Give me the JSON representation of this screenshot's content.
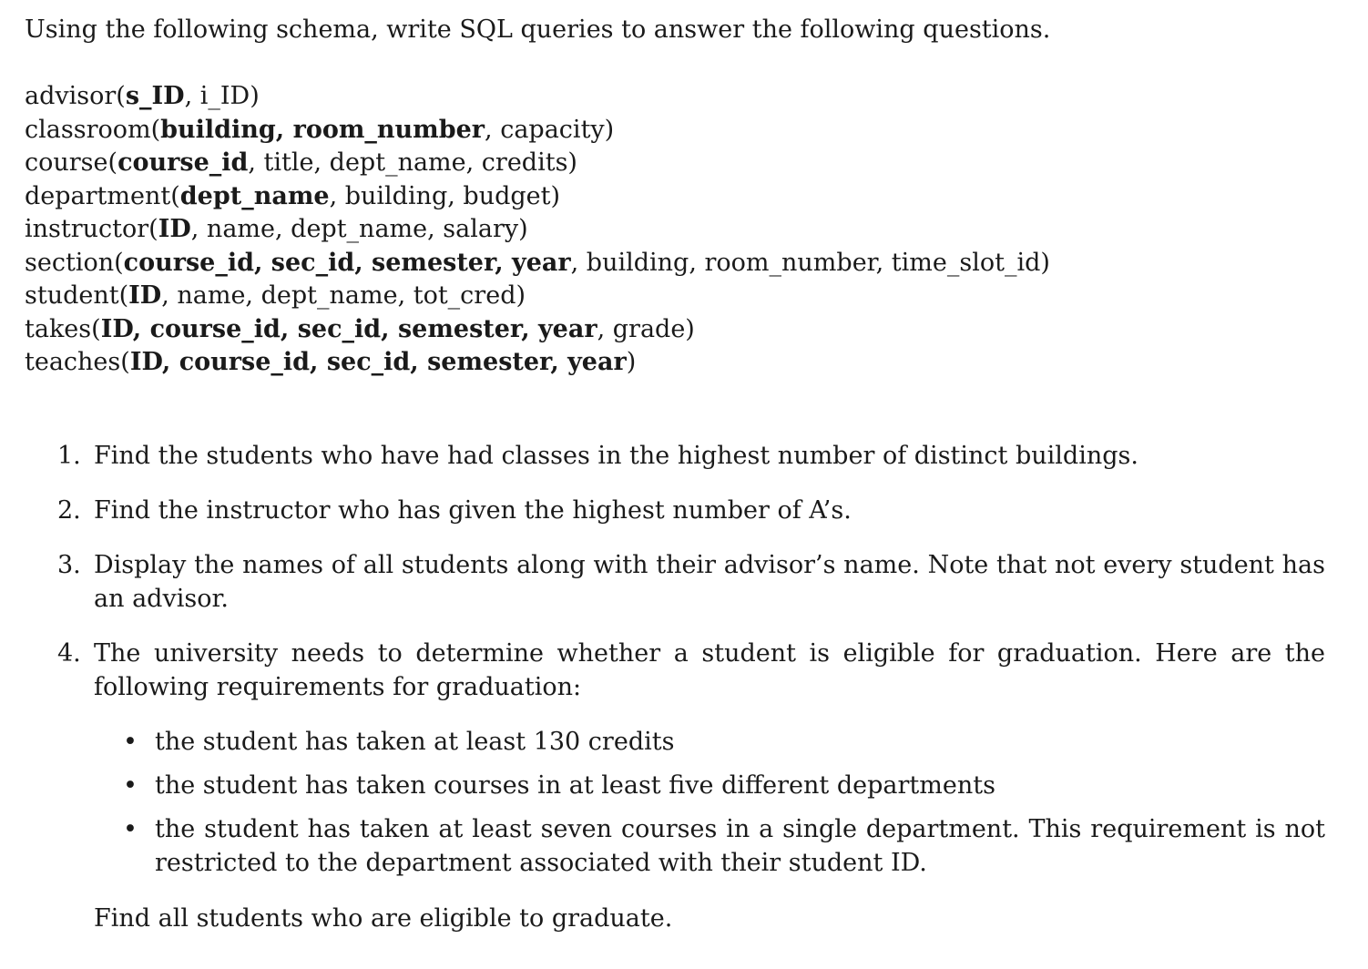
{
  "intro": "Using the following schema, write SQL queries to answer the following questions.",
  "schema": [
    {
      "name": "advisor",
      "open": "(",
      "key": "s_ID",
      "rest": ", i_ID)"
    },
    {
      "name": "classroom",
      "open": "(",
      "key": "building, room_number",
      "rest": ", capacity)"
    },
    {
      "name": "course",
      "open": "(",
      "key": "course_id",
      "rest": ", title, dept_name, credits)"
    },
    {
      "name": "department",
      "open": "(",
      "key": "dept_name",
      "rest": ", building, budget)"
    },
    {
      "name": "instructor",
      "open": "(",
      "key": "ID",
      "rest": ", name, dept_name, salary)"
    },
    {
      "name": "section",
      "open": "(",
      "key": "course_id, sec_id, semester, year",
      "rest": ", building, room_number, time_slot_id)"
    },
    {
      "name": "student",
      "open": "(",
      "key": "ID",
      "rest": ", name, dept_name, tot_cred)"
    },
    {
      "name": "takes",
      "open": "(",
      "key": "ID, course_id, sec_id, semester, year",
      "rest": ", grade)"
    },
    {
      "name": "teaches",
      "open": "(",
      "key": "ID, course_id, sec_id, semester, year",
      "rest": ")"
    }
  ],
  "questions": [
    {
      "num": "1.",
      "text": "Find the students who have had classes in the highest number of distinct buildings."
    },
    {
      "num": "2.",
      "text": "Find the instructor who has given the highest number of A’s."
    },
    {
      "num": "3.",
      "text": "Display the names of all students along with their advisor’s name. Note that not every student has an advisor."
    },
    {
      "num": "4.",
      "text": "The university needs to determine whether a student is eligible for graduation. Here are the following requirements for graduation:"
    }
  ],
  "requirements": [
    {
      "bullet": "•",
      "text": "the student has taken at least 130 credits"
    },
    {
      "bullet": "•",
      "text": "the student has taken courses in at least five different departments"
    },
    {
      "bullet": "•",
      "text": "the student has taken at least seven courses in a single department.  This requirement is not restricted to the department associated with their student ID."
    }
  ],
  "closing": "Find all students who are eligible to graduate."
}
